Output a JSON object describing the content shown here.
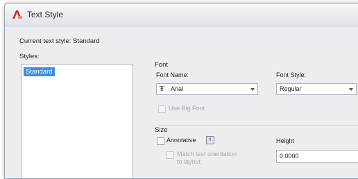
{
  "window": {
    "title": "Text Style"
  },
  "current_style": {
    "label": "Current text style:",
    "value": "Standard"
  },
  "styles": {
    "label": "Styles:",
    "items": [
      "Standard"
    ]
  },
  "font": {
    "title": "Font",
    "name_label": "Font Name:",
    "name_value": "Arial",
    "style_label": "Font Style:",
    "style_value": "Regular",
    "big_font_label": "Use Big Font"
  },
  "size": {
    "title": "Size",
    "annotative_label": "Annotative",
    "match_label_line1": "Match text orientation",
    "match_label_line2": "to layout",
    "height_label": "Height",
    "height_value": "0.0000"
  },
  "colors": {
    "accent": "#3d8fe0",
    "title_icon": "#d12a2a"
  }
}
